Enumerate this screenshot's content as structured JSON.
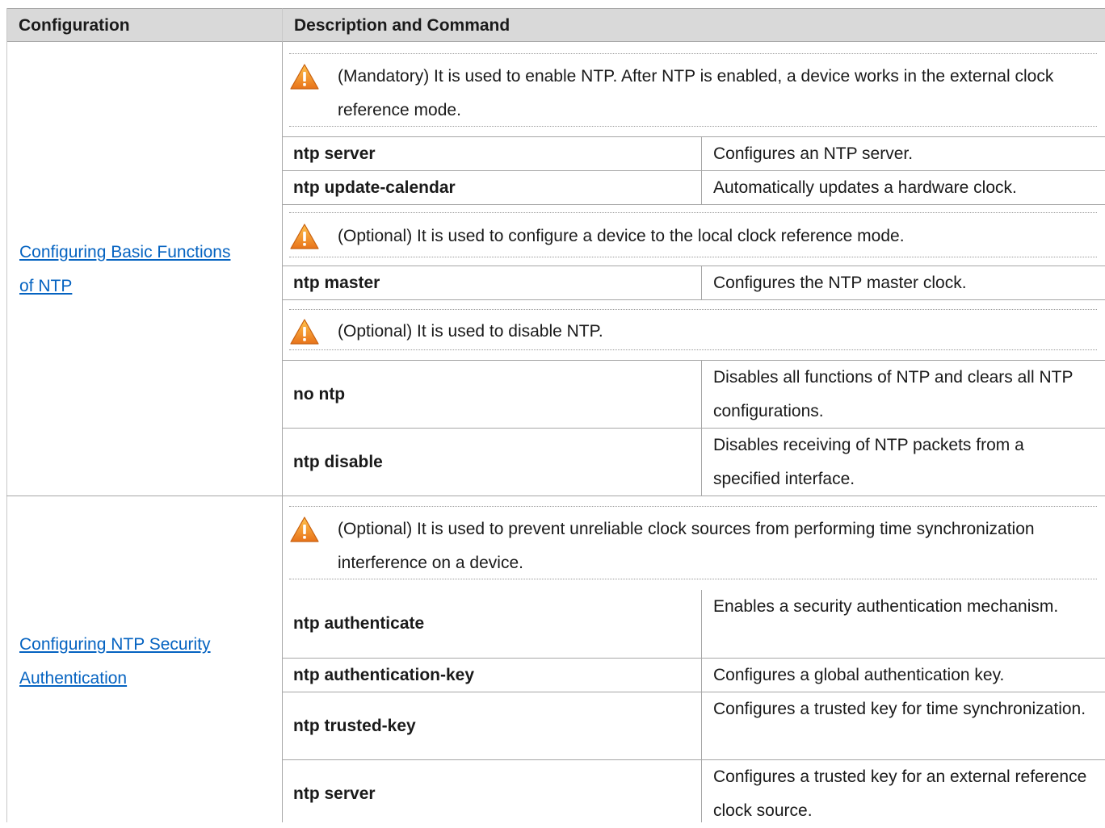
{
  "table": {
    "headers": {
      "configuration": "Configuration",
      "description": "Description and Command"
    },
    "sections": [
      {
        "link_line1": "Configuring Basic Functions ",
        "link_line2": "of NTP",
        "notes": [
          {
            "icon": "warning-icon",
            "text": "(Mandatory) It is used to enable NTP. After NTP is enabled, a device works in the external clock reference mode."
          },
          {
            "icon": "warning-icon",
            "text": "(Optional) It is used to configure a device to the local clock reference mode."
          },
          {
            "icon": "warning-icon",
            "text": "(Optional) It is used to disable NTP."
          }
        ],
        "commands": [
          {
            "cmd": "ntp server",
            "desc": "Configures an NTP server."
          },
          {
            "cmd": "ntp update-calendar",
            "desc": "Automatically updates a hardware clock."
          },
          {
            "cmd": "ntp master",
            "desc": "Configures the NTP master clock."
          },
          {
            "cmd": "no ntp",
            "desc": "Disables all functions of NTP and clears all NTP configurations."
          },
          {
            "cmd": "ntp disable",
            "desc": "Disables receiving of NTP packets from a specified interface."
          }
        ]
      },
      {
        "link_line1": "Configuring NTP Security ",
        "link_line2": "Authentication",
        "notes": [
          {
            "icon": "warning-icon",
            "text": "(Optional) It is used to prevent unreliable clock sources from performing time synchronization interference on a device."
          }
        ],
        "commands": [
          {
            "cmd": "ntp authenticate",
            "desc": "Enables a security authentication mechanism."
          },
          {
            "cmd": "ntp authentication-key",
            "desc": "Configures a global authentication key."
          },
          {
            "cmd": "ntp trusted-key",
            "desc": "Configures a trusted key for time synchronization."
          },
          {
            "cmd": "ntp server",
            "desc": "Configures a trusted key for an external reference clock source."
          }
        ]
      }
    ]
  },
  "colors": {
    "header_bg": "#d9d9d9",
    "link": "#0563c1",
    "warning": "#f5a623",
    "border": "#a6a6a6"
  }
}
